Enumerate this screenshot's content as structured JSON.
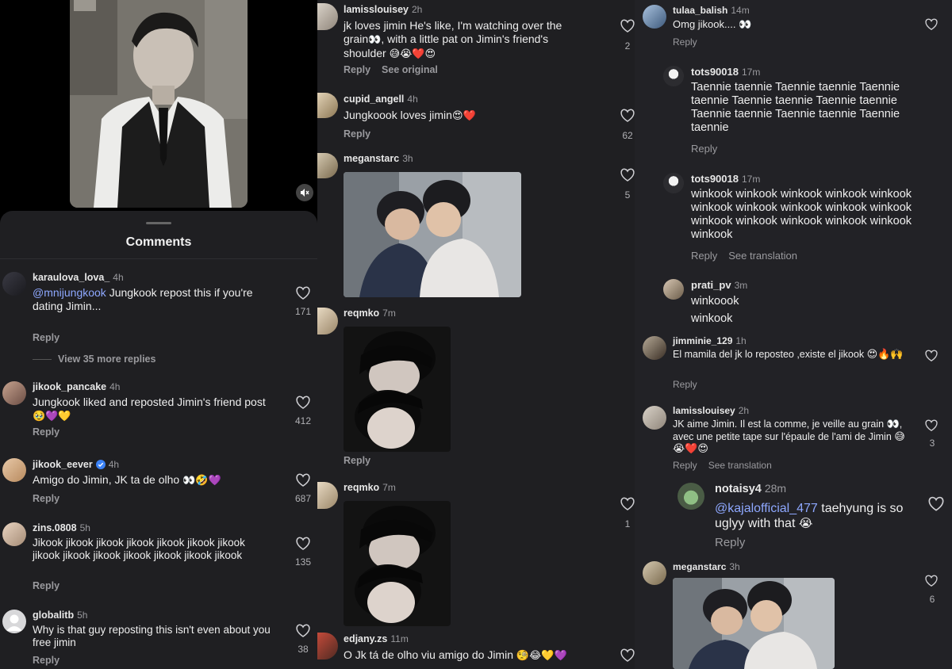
{
  "panel_a": {
    "title": "Comments",
    "comments": [
      {
        "user": "karaulova_lova_",
        "time": "4h",
        "mention": "@mnijungkook",
        "text": " Jungkook repost this if you're dating Jimin...",
        "likes": "171",
        "reply": "Reply",
        "view_more": "View 35 more replies"
      },
      {
        "user": "jikook_pancake",
        "time": "4h",
        "text": "Jungkook liked and reposted Jimin's friend post",
        "emoji": "🥹💜💛",
        "likes": "412",
        "reply": "Reply"
      },
      {
        "user": "jikook_eever",
        "time": "4h",
        "text": "Amigo do Jimin, JK ta de olho",
        "emoji": "👀🤣💜",
        "likes": "687",
        "reply": "Reply"
      },
      {
        "user": "zins.0808",
        "time": "5h",
        "text": "Jikook jikook jikook jikook jikook jikook jikook jikook jikook jikook jikook jikook jikook jikook",
        "likes": "135",
        "reply": "Reply"
      },
      {
        "user": "globalitb",
        "time": "5h",
        "text": "Why is that guy reposting this isn't even about you free jimin",
        "likes": "38",
        "reply": "Reply"
      }
    ]
  },
  "panel_b": {
    "comments": [
      {
        "user": "lamisslouisey",
        "time": "2h",
        "text": "jk loves jimin He's like, I'm watching over the grain",
        "text2": ", with a little pat on Jimin's friend's shoulder",
        "emoji_inline": "👀",
        "emoji": "😅😭❤️😍",
        "likes": "2",
        "reply": "Reply",
        "see_original": "See original"
      },
      {
        "user": "cupid_angell",
        "time": "4h",
        "text": "Jungkoook loves jimin",
        "emoji": "😍❤️",
        "likes": "62",
        "reply": "Reply"
      },
      {
        "user": "meganstarc",
        "time": "3h",
        "likes": "5"
      },
      {
        "user": "reqmko",
        "time": "7m",
        "reply": "Reply"
      },
      {
        "user": "reqmko",
        "time": "7m",
        "likes": "1"
      },
      {
        "user": "edjany.zs",
        "time": "11m",
        "text": "O Jk tá de olho viu amigo do Jimin",
        "emoji": "🧐😂💛💜"
      }
    ]
  },
  "panel_c": {
    "comments": [
      {
        "user": "tulaa_balish",
        "time": "14m",
        "text": "Omg jikook....",
        "emoji": "👀",
        "reply": "Reply"
      },
      {
        "user": "tots90018",
        "time": "17m",
        "text": "Taennie taennie Taennie taennie  Taennie taennie Taennie taennie Taennie taennie Taennie taennie Taennie taennie Taennie taennie",
        "reply": "Reply"
      },
      {
        "user": "tots90018",
        "time": "17m",
        "text": "winkook winkook winkook winkook winkook winkook winkook winkook winkook winkook winkook winkook winkook winkook winkook winkook",
        "reply": "Reply",
        "see_translation": "See translation"
      },
      {
        "user": "prati_pv",
        "time": "3m",
        "line1": "winkoook",
        "line2": "winkook"
      },
      {
        "user": "jimminie_129",
        "time": "1h",
        "text": "El mamila del jk lo reposteo ,existe el jikook",
        "emoji": "😍🔥🙌",
        "reply": "Reply"
      },
      {
        "user": "lamisslouisey",
        "time": "2h",
        "text": "JK aime Jimin. Il est la comme, je veille au grain",
        "emoji_inline": "👀",
        "text2": ", avec une petite tape sur l'épaule de l'ami de Jimin",
        "emoji": "😅😭❤️😍",
        "likes": "3",
        "reply": "Reply",
        "see_translation": "See translation"
      },
      {
        "user": "notaisy4",
        "time": "28m",
        "mention": "@kajalofficial_477",
        "text": " taehyung is so uglyy with that",
        "emoji": "😭",
        "reply": "Reply"
      },
      {
        "user": "meganstarc",
        "time": "3h",
        "likes": "6"
      }
    ]
  },
  "colors": {
    "bg": "#1f1f22",
    "text": "#e8e8e8",
    "muted": "#9a9a9e",
    "mention": "#8ea8ff",
    "verified": "#3b82f6",
    "heart_stroke": "#cfcfd3"
  }
}
